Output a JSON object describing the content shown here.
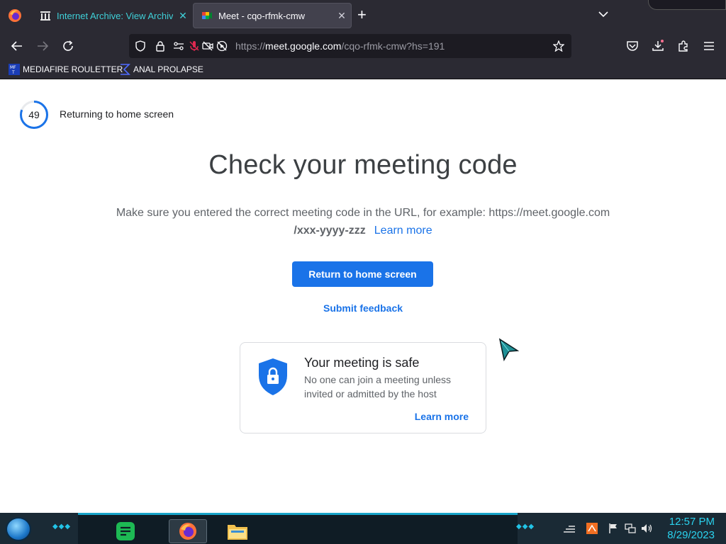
{
  "browser": {
    "tabs": [
      {
        "label": "Internet Archive: View Archive",
        "active": false
      },
      {
        "label": "Meet - cqo-rfmk-cmw",
        "active": true
      }
    ],
    "url_prefix": "https://",
    "url_domain": "meet.google.com",
    "url_path": "/cqo-rfmk-cmw?hs=191",
    "bookmarks": [
      {
        "label": "MEDIAFIRE ROULETTER",
        "icon": "mediafire-icon"
      },
      {
        "label": "ANAL PROLAPSE",
        "icon": "sigma-bookmark-icon"
      }
    ]
  },
  "page": {
    "countdown_value": "49",
    "countdown_label": "Returning to home screen",
    "heading": "Check your meeting code",
    "description_line1": "Make sure you entered the correct meeting code in the URL, for example: https://meet.google.com",
    "description_example": "/xxx-yyyy-zzz",
    "learn_more": "Learn more",
    "primary_button": "Return to home screen",
    "feedback_link": "Submit feedback",
    "safe_card": {
      "title": "Your meeting is safe",
      "body": "No one can join a meeting unless invited or admitted by the host",
      "link": "Learn more"
    }
  },
  "taskbar": {
    "time": "12:57 PM",
    "date": "8/29/2023"
  },
  "colors": {
    "accent_blue": "#1a73e8",
    "tab_active_bg": "#42414d",
    "chrome_bg": "#2b2a33",
    "clock_cyan": "#2ad3ef"
  }
}
